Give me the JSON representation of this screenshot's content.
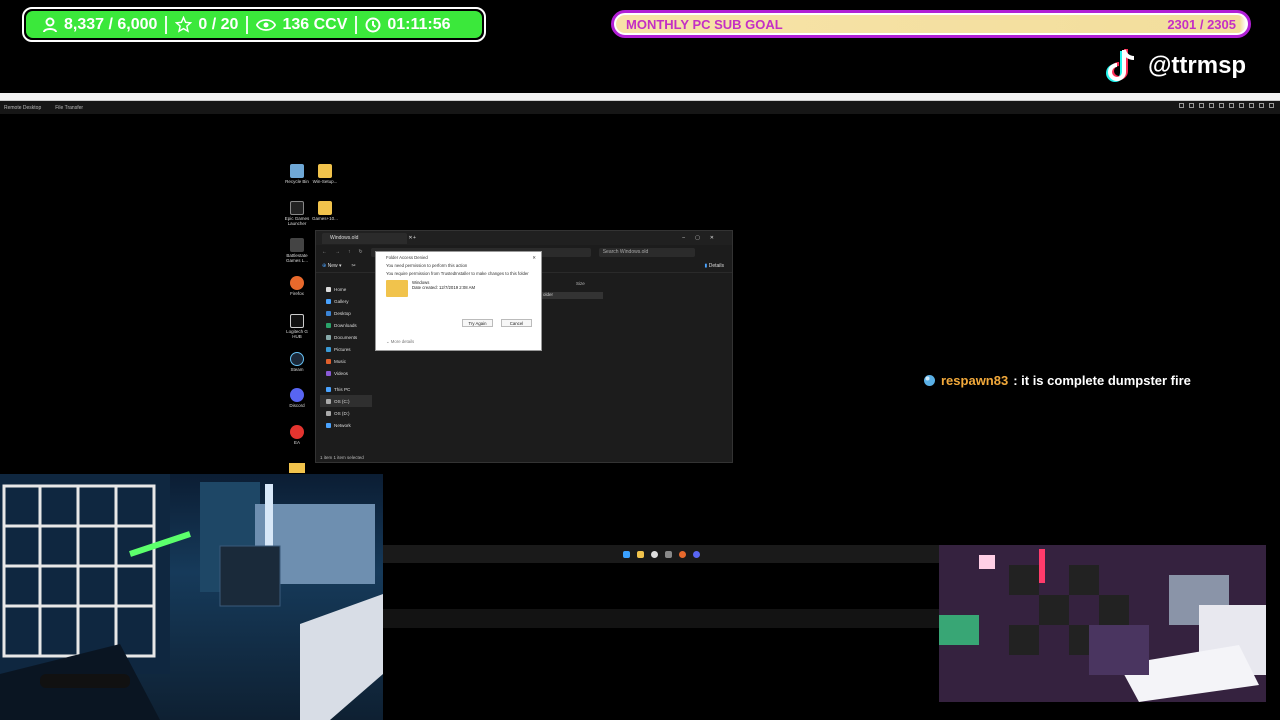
{
  "stats": {
    "followers": "8,337 / 6,000",
    "favorites": "0 / 20",
    "viewers": "136 CCV",
    "uptime": "01:11:56"
  },
  "goal": {
    "label": "MONTHLY PC SUB GOAL",
    "count": "2301 / 2305",
    "progress_fraction": 0.998
  },
  "social": {
    "handle": "@ttrmsp"
  },
  "remote_desktop": {
    "tabs": [
      "Remote Desktop",
      "File Transfer"
    ]
  },
  "desktop": {
    "icons": [
      {
        "label": "Recycle Bin"
      },
      {
        "label": "Win-Setup..."
      },
      {
        "label": "Epic Games Launcher"
      },
      {
        "label": "Games+10..."
      },
      {
        "label": "Battlestate Games L..."
      },
      {
        "label": "Firefox"
      },
      {
        "label": "Logitech G HUB"
      },
      {
        "label": "Steam"
      },
      {
        "label": "Discord"
      },
      {
        "label": "EA"
      }
    ]
  },
  "explorer": {
    "tab_title": "Windows.old",
    "search_placeholder": "Search Windows.old",
    "new_label": "New",
    "details_label": "Details",
    "column_size": "Size",
    "sidebar": [
      "Home",
      "Gallery",
      "Desktop",
      "Downloads",
      "Documents",
      "Pictures",
      "Music",
      "Videos",
      "This PC",
      "OS (C:)",
      "OS (D:)",
      "Network"
    ],
    "status": "1 item    1 item selected",
    "selected_row": "older"
  },
  "dialog": {
    "title": "Folder Access Denied",
    "line1": "You need permission to perform this action",
    "line2": "You require permission from TrustedInstaller to make changes to this folder",
    "folder_name": "Windows",
    "folder_date": "Date created: 12/7/2019 2:08 AM",
    "try_again": "Try Again",
    "cancel": "Cancel",
    "more": "More details"
  },
  "chat": {
    "user": "respawn83",
    "message": ": it is complete dumpster fire"
  }
}
